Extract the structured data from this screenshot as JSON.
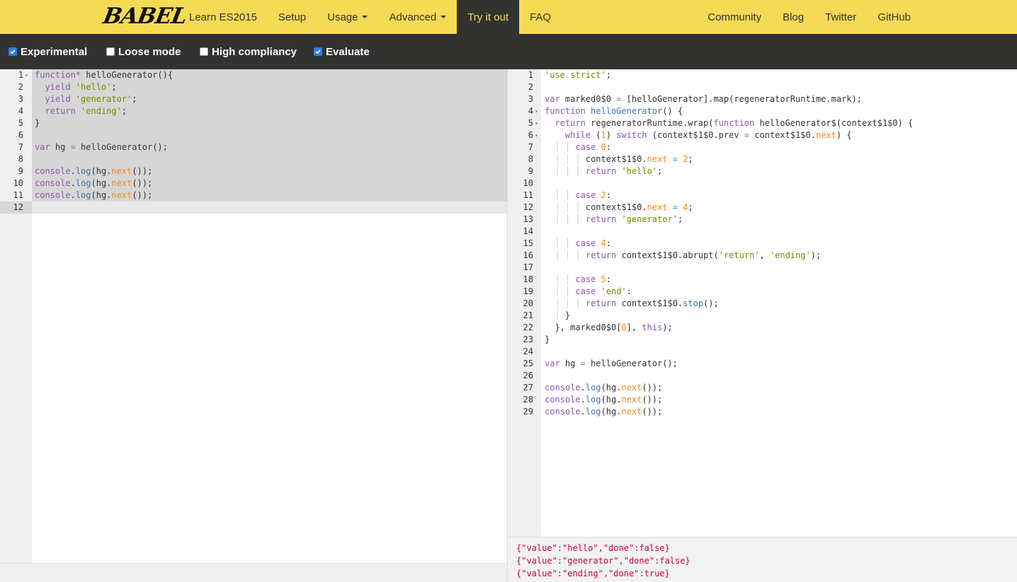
{
  "brand": {
    "logo_text": "BABEL"
  },
  "nav": {
    "left": [
      {
        "label": "Learn ES2015"
      },
      {
        "label": "Setup"
      },
      {
        "label": "Usage",
        "dropdown": true
      },
      {
        "label": "Advanced",
        "dropdown": true
      },
      {
        "label": "Try it out",
        "active": true
      },
      {
        "label": "FAQ"
      }
    ],
    "right": [
      {
        "label": "Community"
      },
      {
        "label": "Blog"
      },
      {
        "label": "Twitter"
      },
      {
        "label": "GitHub"
      }
    ]
  },
  "options": [
    {
      "label": "Experimental",
      "checked": true
    },
    {
      "label": "Loose mode",
      "checked": false
    },
    {
      "label": "High compliancy",
      "checked": false
    },
    {
      "label": "Evaluate",
      "checked": true
    }
  ],
  "input_code": [
    "function* helloGenerator(){",
    "  yield 'hello';",
    "  yield 'generator';",
    "  return 'ending';",
    "}",
    "",
    "var hg = helloGenerator();",
    "",
    "console.log(hg.next());",
    "console.log(hg.next());",
    "console.log(hg.next());",
    ""
  ],
  "output_code": [
    "'use strict';",
    "",
    "var marked0$0 = [helloGenerator].map(regeneratorRuntime.mark);",
    "function helloGenerator() {",
    "  return regeneratorRuntime.wrap(function helloGenerator$(context$1$0) {",
    "    while (1) switch (context$1$0.prev = context$1$0.next) {",
    "      case 0:",
    "        context$1$0.next = 2;",
    "        return 'hello';",
    "",
    "      case 2:",
    "        context$1$0.next = 4;",
    "        return 'generator';",
    "",
    "      case 4:",
    "        return context$1$0.abrupt('return', 'ending');",
    "",
    "      case 5:",
    "      case 'end':",
    "        return context$1$0.stop();",
    "    }",
    "  }, marked0$0[0], this);",
    "}",
    "",
    "var hg = helloGenerator();",
    "",
    "console.log(hg.next());",
    "console.log(hg.next());",
    "console.log(hg.next());"
  ],
  "console_output": [
    "{\"value\":\"hello\",\"done\":false}",
    "{\"value\":\"generator\",\"done\":false}",
    "{\"value\":\"ending\",\"done\":true}"
  ],
  "colors": {
    "navbar_bg": "#f5da55",
    "navbar_dark": "#323330",
    "checkbox_checked": "#2d7de4",
    "console_text": "#c4003c"
  }
}
